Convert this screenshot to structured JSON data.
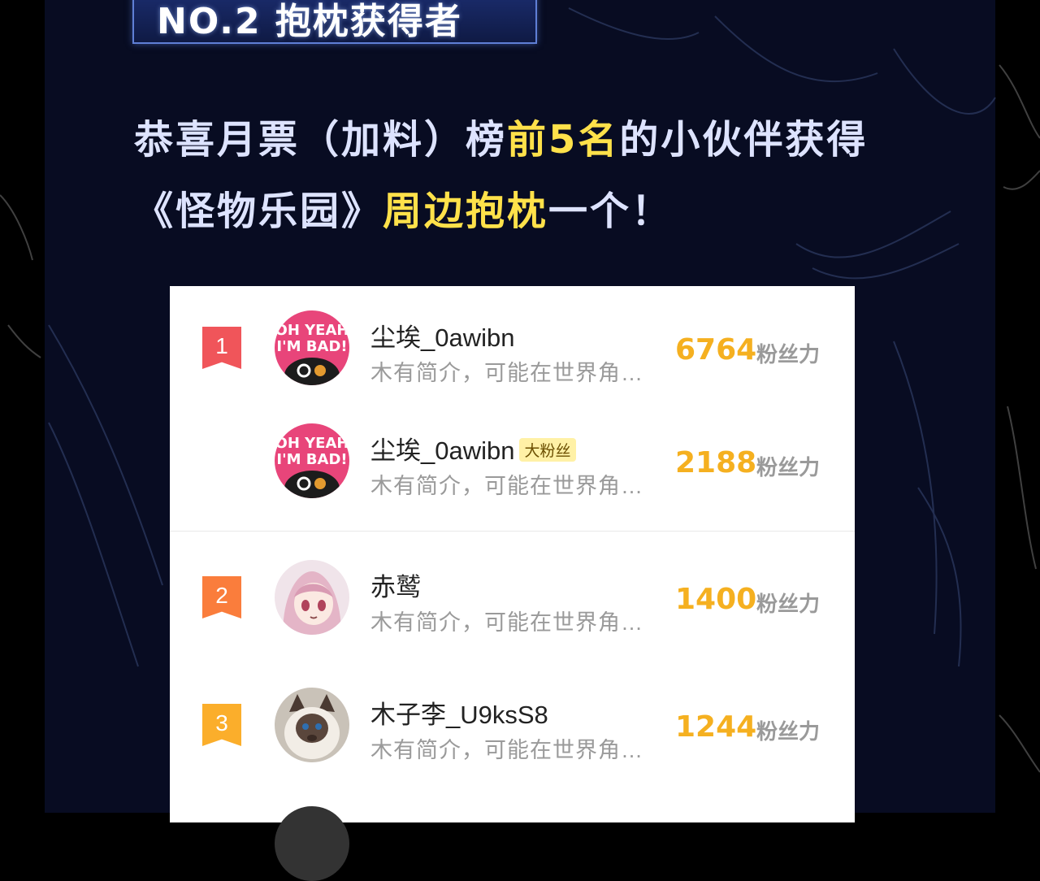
{
  "badge": {
    "text": "NO.2 抱枕获得者"
  },
  "headline": {
    "line1": [
      {
        "text": "恭喜月票（加料）榜",
        "highlight": false
      },
      {
        "text": "前5名",
        "highlight": true
      },
      {
        "text": "的小伙伴获得",
        "highlight": false
      }
    ],
    "line2": [
      {
        "text": "《怪物乐园》",
        "highlight": false
      },
      {
        "text": "周边抱枕",
        "highlight": true
      },
      {
        "text": "一个！",
        "highlight": false
      }
    ]
  },
  "leaderboard": {
    "unit_label": "粉丝力",
    "rows": [
      {
        "rank": "1",
        "rank_color": "#f0555a",
        "name": "尘埃_0awibn",
        "tag": "",
        "bio": "木有简介，可能在世界角…",
        "score": "6764",
        "avatar": "oh-yeah-im-bad-icon"
      },
      {
        "rank": "",
        "rank_color": "",
        "name": "尘埃_0awibn",
        "tag": "大粉丝",
        "bio": "木有简介，可能在世界角…",
        "score": "2188",
        "avatar": "oh-yeah-im-bad-icon"
      },
      {
        "rank": "2",
        "rank_color": "#fa7d3c",
        "name": "赤鹫",
        "tag": "",
        "bio": "木有简介，可能在世界角…",
        "score": "1400",
        "avatar": "anime-girl-icon"
      },
      {
        "rank": "3",
        "rank_color": "#fbae2b",
        "name": "木子李_U9ksS8",
        "tag": "",
        "bio": "木有简介，可能在世界角…",
        "score": "1244",
        "avatar": "cat-icon"
      }
    ]
  },
  "colors": {
    "background": "#080c22",
    "highlight": "#ffe14a",
    "score": "#f5b020"
  }
}
